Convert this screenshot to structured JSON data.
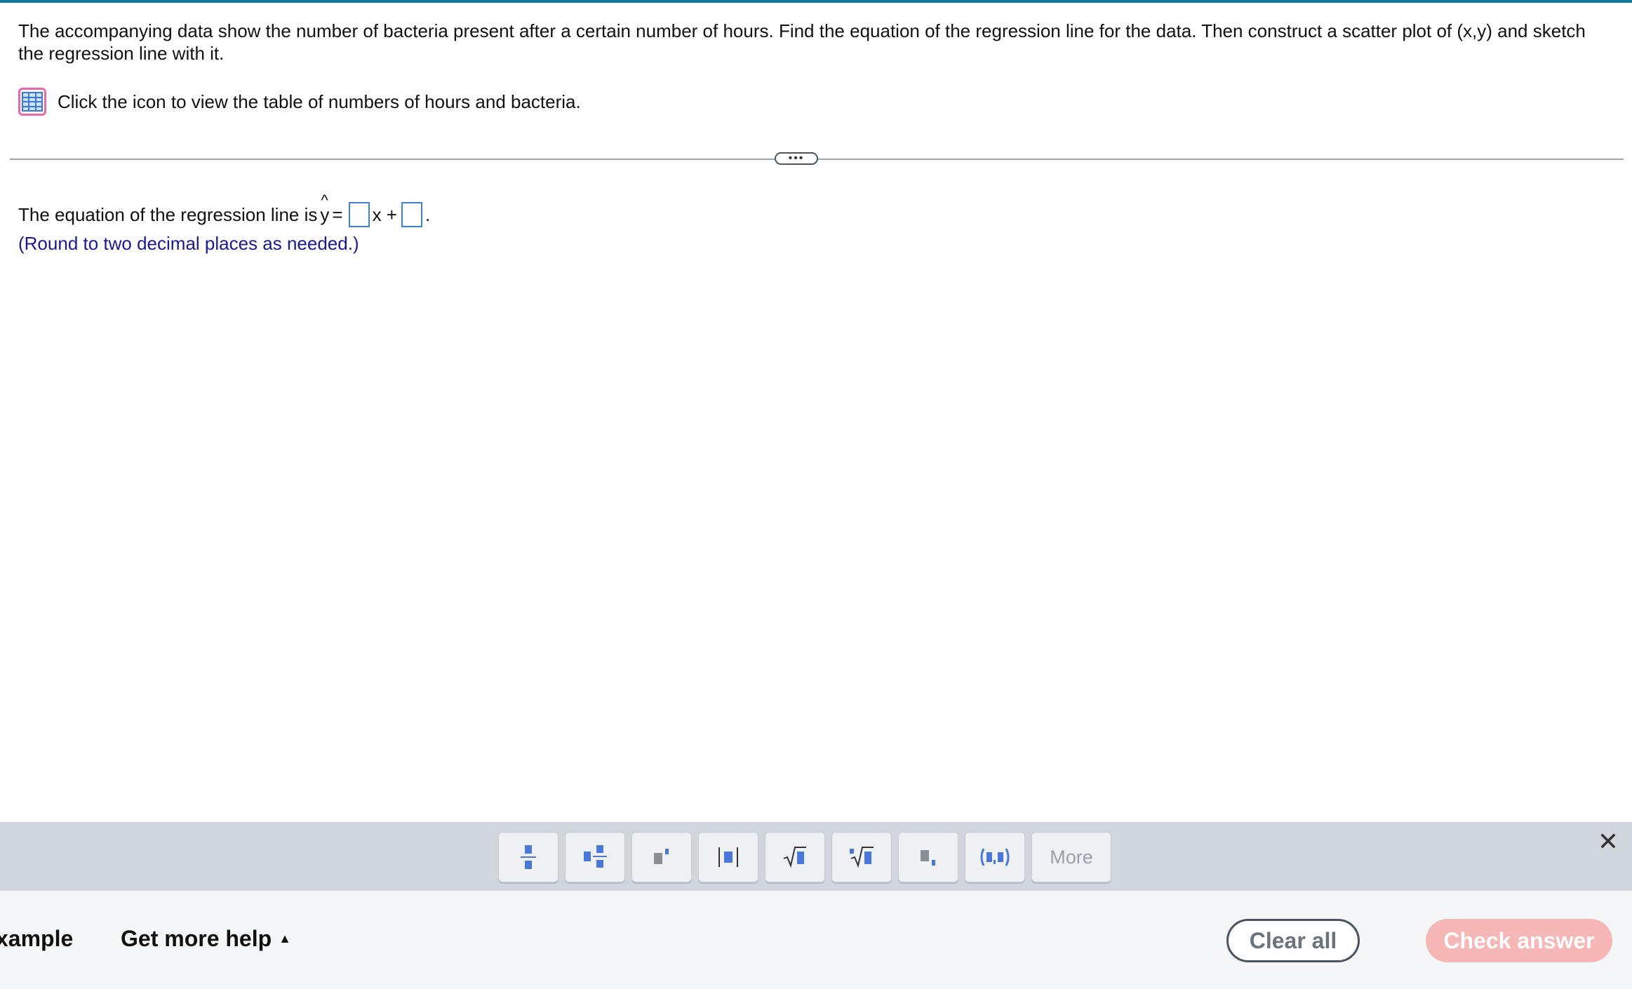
{
  "question": {
    "text": "The accompanying data show the number of bacteria present after a certain number of hours. Find the equation of the regression line for the data. Then construct a scatter plot of (x,y) and sketch the regression line with it.",
    "table_hint": "Click the icon to view the table of numbers of hours and bacteria."
  },
  "expander": {
    "label": "•••"
  },
  "answer": {
    "prefix": "The equation of the regression line is",
    "y": "y",
    "hat": "^",
    "equals": "=",
    "x_plus": "x +",
    "period": ".",
    "round_note": "(Round to two decimal places as needed.)"
  },
  "toolbar": {
    "buttons": [
      "fraction-icon",
      "mixed-number-icon",
      "exponent-icon",
      "absolute-value-icon",
      "square-root-icon",
      "nth-root-icon",
      "subscript-icon",
      "ordered-pair-icon"
    ],
    "more_label": "More",
    "close_label": "✕"
  },
  "footer": {
    "example_label": "xample",
    "help_label": "Get more help",
    "help_caret": "▲",
    "clear_label": "Clear all",
    "check_label": "Check answer"
  },
  "colors": {
    "accent_strip": "#137a9c",
    "input_box_border": "#3f80d0",
    "note_text": "#1a1a8c",
    "check_button": "#f6b7b7",
    "toolbar_bg": "#d1d6dd",
    "tool_glyph": "#4a78d6"
  }
}
